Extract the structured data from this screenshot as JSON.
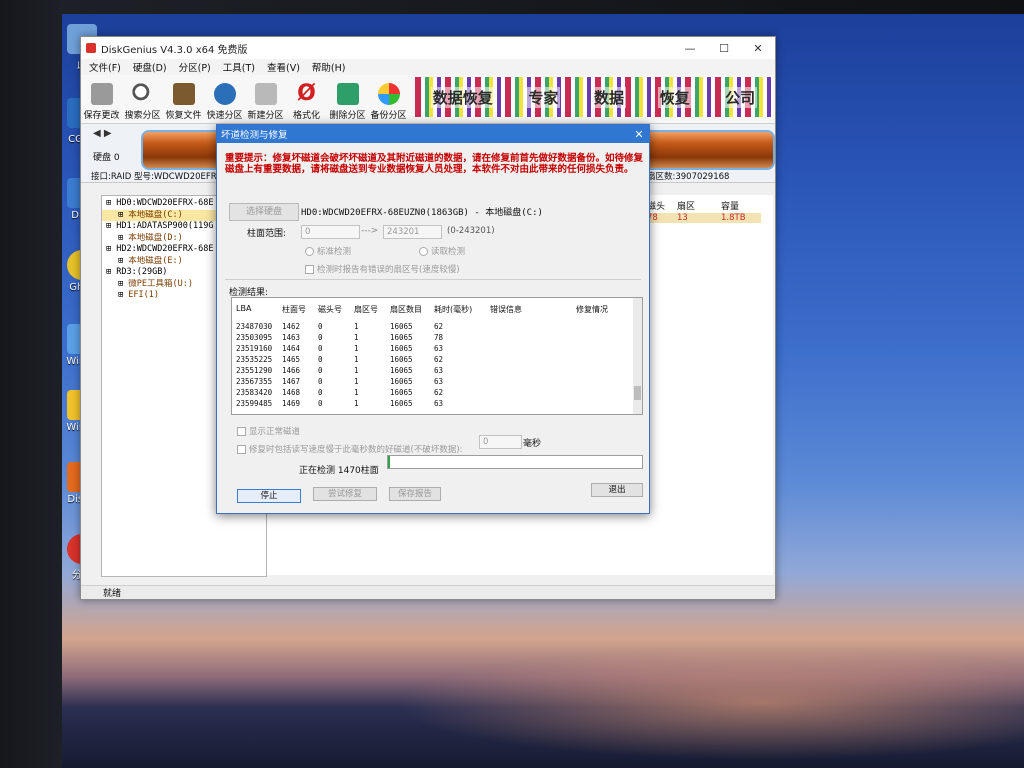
{
  "window": {
    "title": "DiskGenius V4.3.0 x64 免费版",
    "menu": [
      "文件(F)",
      "硬盘(D)",
      "分区(P)",
      "工具(T)",
      "查看(V)",
      "帮助(H)"
    ],
    "toolbar": [
      "保存更改",
      "搜索分区",
      "恢复文件",
      "快速分区",
      "新建分区",
      "格式化",
      "删除分区",
      "备份分区"
    ],
    "banner_text": [
      "数据恢复",
      "专家",
      "数据",
      "恢复",
      "公司"
    ],
    "status": "就绪"
  },
  "disk_panel": {
    "disk_label": "硬盘 0",
    "interface": "接口:RAID  型号:WDCWD20EFRX-",
    "sectors": "扇区数:3907029168",
    "columns": [
      "磁头",
      "扇区",
      "容量"
    ],
    "row": [
      "78",
      "13",
      "1.8TB"
    ]
  },
  "tree": [
    {
      "text": "HD0:WDCWD20EFRX-68E",
      "indent": 0,
      "type": "disk"
    },
    {
      "text": "本地磁盘(C:)",
      "indent": 1,
      "type": "part",
      "selected": true
    },
    {
      "text": "HD1:ADATASP900(119G",
      "indent": 0,
      "type": "disk"
    },
    {
      "text": "本地磁盘(D:)",
      "indent": 1,
      "type": "part"
    },
    {
      "text": "HD2:WDCWD20EFRX-68E",
      "indent": 0,
      "type": "disk"
    },
    {
      "text": "本地磁盘(E:)",
      "indent": 1,
      "type": "part"
    },
    {
      "text": "RD3:(29GB)",
      "indent": 0,
      "type": "disk"
    },
    {
      "text": "微PE工具箱(U:)",
      "indent": 1,
      "type": "part"
    },
    {
      "text": "EFI(1)",
      "indent": 1,
      "type": "part"
    }
  ],
  "dialog": {
    "title": "坏道检测与修复",
    "warning": "重要提示：修复坏磁道会破坏坏磁道及其附近磁道的数据，请在修复前首先做好数据备份。如待修复磁盘上有重要数据，请将磁盘送到专业数据恢复人员处理，本软件不对由此带来的任何损失负责。",
    "select_disk_btn": "选择硬盘",
    "disk_desc": "HD0:WDCWD20EFRX-68EUZN0(1863GB) - 本地磁盘(C:)",
    "cylinder_label": "柱面范围:",
    "cyl_from": "0",
    "cyl_arrow": "--->",
    "cyl_to": "243201",
    "cyl_range": "(0-243201)",
    "radio_standard": "标准检测",
    "radio_quick": "读取检测",
    "check_report": "检测时报告有错误的扇区号(速度较慢)",
    "results_label": "检测结果:",
    "result_columns": [
      "LBA",
      "柱面号",
      "磁头号",
      "扇区号",
      "扇区数目",
      "耗时(毫秒)",
      "错误信息",
      "修复情况"
    ],
    "result_rows": [
      [
        "23487030",
        "1462",
        "0",
        "1",
        "16065",
        "62"
      ],
      [
        "23503095",
        "1463",
        "0",
        "1",
        "16065",
        "78"
      ],
      [
        "23519160",
        "1464",
        "0",
        "1",
        "16065",
        "63"
      ],
      [
        "23535225",
        "1465",
        "0",
        "1",
        "16065",
        "62"
      ],
      [
        "23551290",
        "1466",
        "0",
        "1",
        "16065",
        "63"
      ],
      [
        "23567355",
        "1467",
        "0",
        "1",
        "16065",
        "63"
      ],
      [
        "23583420",
        "1468",
        "0",
        "1",
        "16065",
        "62"
      ],
      [
        "23599485",
        "1469",
        "0",
        "1",
        "16065",
        "63"
      ]
    ],
    "show_normal": "显示正常磁道",
    "repair_option": "修复时包括读写速度慢于此毫秒数的好磁道(不破坏数据):",
    "ms_value": "0",
    "ms_unit": "毫秒",
    "checking_label": "正在检测 1470柱面",
    "progress": 0.006,
    "btn_stop": "停止",
    "btn_repair": "尝试修复",
    "btn_save": "保存报告",
    "btn_exit": "退出"
  }
}
